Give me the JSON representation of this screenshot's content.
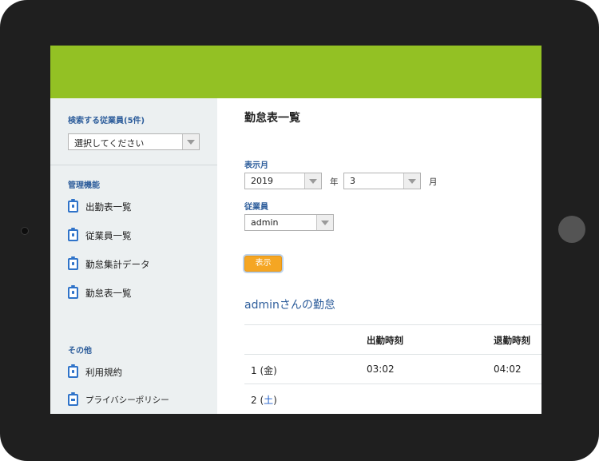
{
  "sidebar": {
    "employee_search_label": "検索する従業員(5件)",
    "employee_select": "選択してください",
    "admin_section_label": "管理機能",
    "admin_items": [
      {
        "label": "出勤表一覧"
      },
      {
        "label": "従業員一覧"
      },
      {
        "label": "勤怠集計データ"
      },
      {
        "label": "勤怠表一覧"
      }
    ],
    "other_section_label": "その他",
    "other_items": [
      {
        "label": "利用規約"
      },
      {
        "label": "プライバシーポリシー"
      }
    ]
  },
  "main": {
    "page_title": "勤怠表一覧",
    "month_label": "表示月",
    "year_value": "2019",
    "year_unit": "年",
    "month_value": "3",
    "month_unit": "月",
    "employee_label": "従業員",
    "employee_value": "admin",
    "show_button": "表示",
    "section_title": "adminさんの勤怠",
    "table": {
      "headers": [
        "",
        "出勤時刻",
        "退勤時刻"
      ],
      "rows": [
        {
          "day": "1",
          "weekday": "金",
          "clock_in": "03:02",
          "clock_out": "04:02"
        },
        {
          "day": "2",
          "weekday": "土",
          "clock_in": "",
          "clock_out": ""
        }
      ]
    }
  },
  "colors": {
    "header_green": "#93c124",
    "accent_blue": "#2d5d9b",
    "button_orange": "#f5a623",
    "device_bezel": "#1f1f1f",
    "sidebar_bg": "#ecf0f1"
  }
}
